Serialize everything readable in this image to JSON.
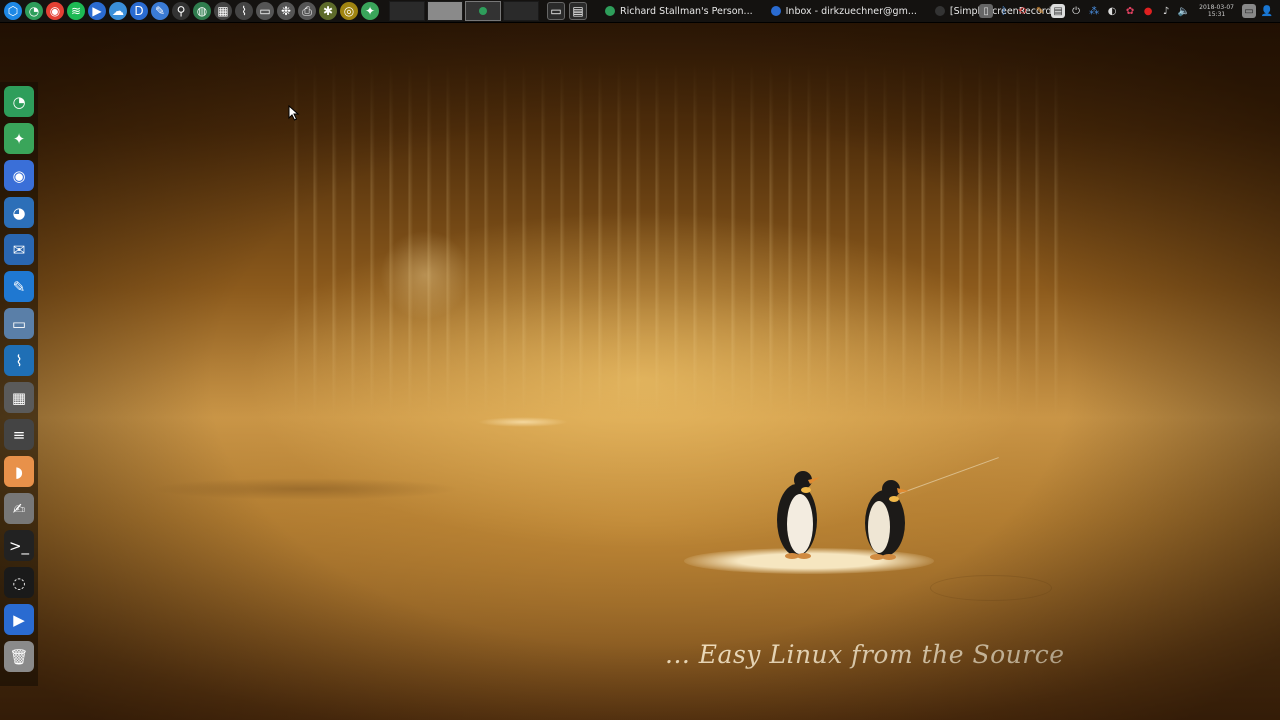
{
  "wallpaper": {
    "tagline": "... Easy Linux from the Source"
  },
  "top_panel": {
    "launchers": [
      {
        "name": "plasma-menu-icon",
        "color": "#1e88e5",
        "glyph": "⬡"
      },
      {
        "name": "green-browser-icon",
        "color": "#2e9e5b",
        "glyph": "◔"
      },
      {
        "name": "chrome-icon",
        "color": "#e44134",
        "glyph": "◉"
      },
      {
        "name": "spotify-icon",
        "color": "#1db954",
        "glyph": "≋"
      },
      {
        "name": "media-player-icon",
        "color": "#2a6bd1",
        "glyph": "▶"
      },
      {
        "name": "cloud-icon",
        "color": "#3a8fd9",
        "glyph": "☁"
      },
      {
        "name": "document-icon",
        "color": "#2a6bd1",
        "glyph": "D"
      },
      {
        "name": "text-editor-icon",
        "color": "#3a7bd5",
        "glyph": "✎"
      },
      {
        "name": "search-icon",
        "color": "#333333",
        "glyph": "⚲"
      },
      {
        "name": "globe-icon",
        "color": "#2f7d4e",
        "glyph": "◍"
      },
      {
        "name": "calculator-icon",
        "color": "#444444",
        "glyph": "▦"
      },
      {
        "name": "system-monitor-icon",
        "color": "#444444",
        "glyph": "⌇"
      },
      {
        "name": "file-manager-icon",
        "color": "#555555",
        "glyph": "▭"
      },
      {
        "name": "settings-icon",
        "color": "#555555",
        "glyph": "❉"
      },
      {
        "name": "printer-icon",
        "color": "#555555",
        "glyph": "⎙"
      },
      {
        "name": "bug-icon",
        "color": "#5d6b2a",
        "glyph": "✱"
      },
      {
        "name": "yellow-app-icon",
        "color": "#a08410",
        "glyph": "◎"
      },
      {
        "name": "green-app-icon",
        "color": "#3aa55a",
        "glyph": "✦"
      }
    ],
    "tasks": [
      {
        "label": "Richard Stallman's Person...",
        "icon_color": "#2e9e5b"
      },
      {
        "label": "Inbox - dirkzuechner@gm...",
        "icon_color": "#2a6bd1"
      },
      {
        "label": "[SimpleScreenRecorder]",
        "icon_color": "#333333"
      }
    ],
    "clock": {
      "date": "2018-03-07",
      "time": "15:31"
    }
  },
  "dock": {
    "items": [
      {
        "name": "dock-browser-icon",
        "color": "#2e9e5b",
        "glyph": "◔"
      },
      {
        "name": "dock-green-globe-icon",
        "color": "#3aa55a",
        "glyph": "✦"
      },
      {
        "name": "dock-chrome-icon",
        "color": "#3a6fd8",
        "glyph": "◉"
      },
      {
        "name": "dock-firefox-icon",
        "color": "#2c6fb8",
        "glyph": "◕"
      },
      {
        "name": "dock-thunderbird-icon",
        "color": "#2a66b0",
        "glyph": "✉"
      },
      {
        "name": "dock-writer-icon",
        "color": "#1f78d1",
        "glyph": "✎"
      },
      {
        "name": "dock-folder-icon",
        "color": "#5a7fa8",
        "glyph": "▭"
      },
      {
        "name": "dock-system-monitor-icon",
        "color": "#1f6fb5",
        "glyph": "⌇"
      },
      {
        "name": "dock-calculator-icon",
        "color": "#5a5a5a",
        "glyph": "▦"
      },
      {
        "name": "dock-scanner-icon",
        "color": "#444444",
        "glyph": "≡"
      },
      {
        "name": "dock-orange-app-icon",
        "color": "#e8914a",
        "glyph": "◗"
      },
      {
        "name": "dock-text-editor-icon",
        "color": "#777777",
        "glyph": "✍"
      },
      {
        "name": "dock-terminal-icon",
        "color": "#222222",
        "glyph": ">_"
      },
      {
        "name": "dock-obs-icon",
        "color": "#1a1a1a",
        "glyph": "◌"
      },
      {
        "name": "dock-media-player-icon",
        "color": "#2a6bd1",
        "glyph": "▶"
      },
      {
        "name": "dock-trash-icon",
        "color": "#8a8a8a",
        "glyph": "🗑"
      }
    ]
  }
}
